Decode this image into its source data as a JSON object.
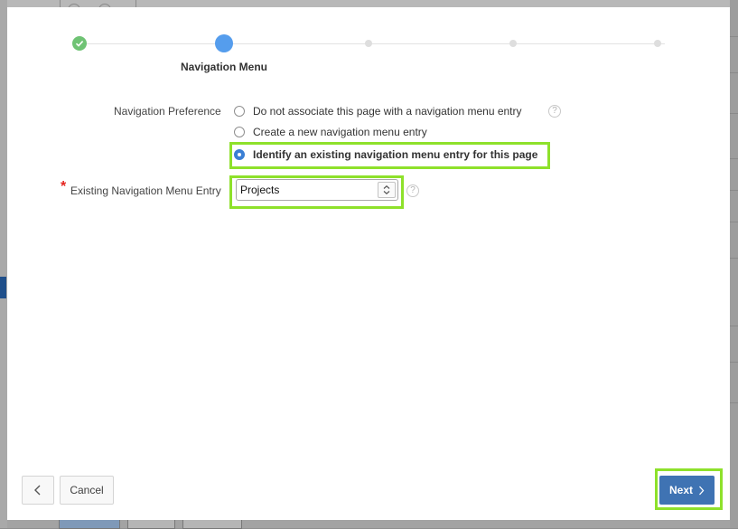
{
  "wizard": {
    "current_step_label": "Navigation Menu"
  },
  "form": {
    "navigation_preference": {
      "label": "Navigation Preference",
      "options": [
        {
          "label": "Do not associate this page with a navigation menu entry",
          "selected": false
        },
        {
          "label": "Create a new navigation menu entry",
          "selected": false
        },
        {
          "label": "Identify an existing navigation menu entry for this page",
          "selected": true
        }
      ],
      "help_icon": "?"
    },
    "existing_entry": {
      "required_mark": "*",
      "label": "Existing Navigation Menu Entry",
      "value": "Projects",
      "help_icon": "?"
    }
  },
  "footer": {
    "cancel_label": "Cancel",
    "next_label": "Next"
  },
  "colors": {
    "highlight": "#8ee12b",
    "primary_button": "#3f73b3",
    "step_done": "#6fc374",
    "step_current": "#559ded"
  },
  "icons": {
    "back": "chevron-left-icon",
    "next": "chevron-right-icon",
    "select": "select-arrows-icon",
    "step_done": "check-icon",
    "help": "help-icon"
  }
}
